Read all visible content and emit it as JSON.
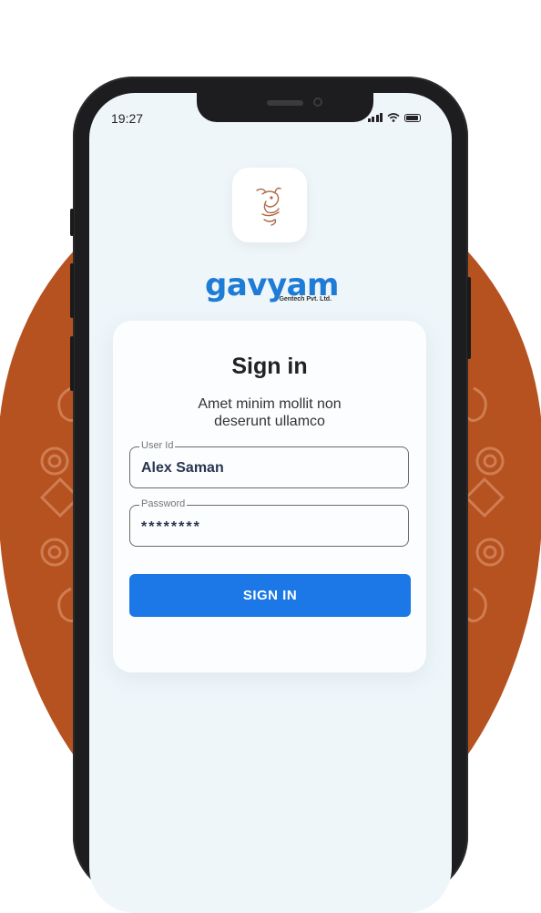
{
  "status_bar": {
    "time": "19:27",
    "icons": [
      "signal-icon",
      "wifi-icon",
      "battery-icon"
    ]
  },
  "brand": {
    "name": "gavyam",
    "subtitle": "Gentech Pvt. Ltd."
  },
  "signin": {
    "title": "Sign in",
    "subtitle": "Amet minim mollit non deserunt ullamco",
    "user_id": {
      "label": "User Id",
      "value": "Alex Saman"
    },
    "password": {
      "label": "Password",
      "value": "********"
    },
    "button_label": "SIGN IN"
  },
  "colors": {
    "accent": "#1b78e6",
    "brand": "#1e7bd6",
    "backdrop": "#b65220",
    "screen": "#eef6fa"
  }
}
